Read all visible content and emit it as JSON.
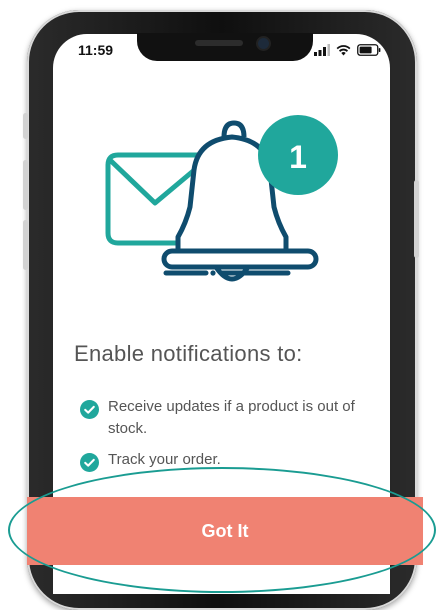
{
  "status_bar": {
    "time": "11:59",
    "signal_icon": "signal-bars-icon",
    "wifi_icon": "wifi-icon",
    "battery_icon": "battery-icon"
  },
  "illustration": {
    "envelope_icon": "envelope-icon",
    "bell_icon": "bell-icon",
    "badge_count": "1",
    "colors": {
      "teal": "#20a79c",
      "navy": "#0f4c6e"
    }
  },
  "content": {
    "heading": "Enable notifications to:",
    "bullets": [
      {
        "icon": "check-circle-icon",
        "text": "Receive updates if a product is out of stock."
      },
      {
        "icon": "check-circle-icon",
        "text": "Track your order."
      }
    ]
  },
  "action": {
    "got_it_label": "Got It",
    "button_color": "#f08272",
    "highlight_color": "#1a9c92"
  }
}
